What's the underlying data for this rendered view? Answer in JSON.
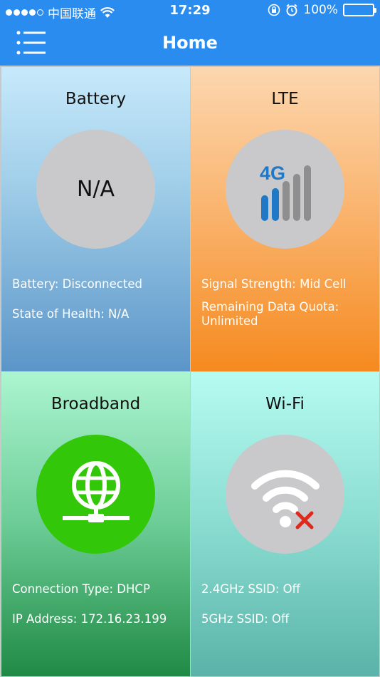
{
  "status_bar": {
    "carrier": "中国联通",
    "time": "17:29",
    "battery_percent": "100%",
    "signal_icon": "signal-dots-icon",
    "wifi_icon": "wifi-icon",
    "lock_icon": "orientation-lock-icon",
    "alarm_icon": "alarm-icon"
  },
  "nav": {
    "title": "Home",
    "menu_icon": "menu-list-icon"
  },
  "tiles": {
    "battery": {
      "title": "Battery",
      "circle_text": "N/A",
      "line1": "Battery: Disconnected",
      "line2": "State of Health: N/A"
    },
    "lte": {
      "title": "LTE",
      "icon": "4g-signal-icon",
      "icon_text": "4G",
      "line1": "Signal Strength: Mid Cell",
      "line2": "Remaining Data Quota: Unlimited"
    },
    "broadband": {
      "title": "Broadband",
      "icon": "globe-network-icon",
      "line1": "Connection Type: DHCP",
      "line2": "IP Address: 172.16.23.199"
    },
    "wifi": {
      "title": "Wi-Fi",
      "icon": "wifi-disconnected-icon",
      "line1": "2.4GHz SSID: Off",
      "line2": "5GHz SSID: Off"
    }
  },
  "colors": {
    "primary": "#2b8cf0",
    "broadband_circle": "#33c70a",
    "wifi_cross": "#e0281c",
    "lte_blue": "#1f79c6"
  }
}
